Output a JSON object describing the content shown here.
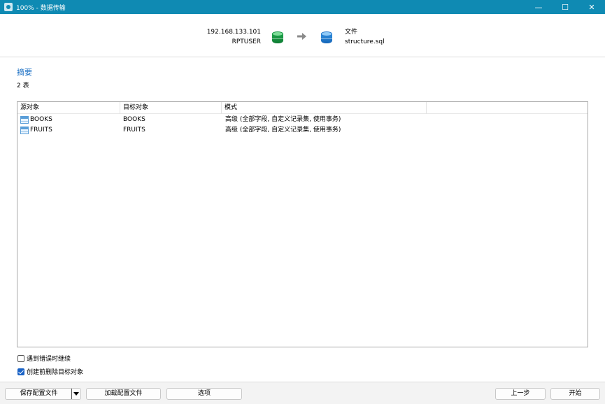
{
  "window": {
    "title": "100% - 数据传输",
    "minimize": "—",
    "maximize": "☐",
    "close": "✕"
  },
  "transfer": {
    "source_host": "192.168.133.101",
    "source_user": "RPTUSER",
    "target_type": "文件",
    "target_file": "structure.sql"
  },
  "summary": {
    "heading": "摘要",
    "count": "2 表"
  },
  "table": {
    "columns": [
      "源对象",
      "目标对象",
      "模式"
    ],
    "rows": [
      {
        "source": "BOOKS",
        "target": "BOOKS",
        "mode": "高级 (全部字段, 自定义记录集, 使用事务)"
      },
      {
        "source": "FRUITS",
        "target": "FRUITS",
        "mode": "高级 (全部字段, 自定义记录集, 使用事务)"
      }
    ]
  },
  "options": {
    "continue_on_error": {
      "label": "遇到错误时继续",
      "checked": false
    },
    "drop_before_create": {
      "label": "创建前删除目标对象",
      "checked": true
    }
  },
  "footer": {
    "save_profile": "保存配置文件",
    "load_profile": "加载配置文件",
    "options": "选项",
    "back": "上一步",
    "start": "开始"
  },
  "colors": {
    "titlebar": "#0f8ab3",
    "accent": "#1a6fc4",
    "checkbox_checked": "#1a63c6"
  }
}
